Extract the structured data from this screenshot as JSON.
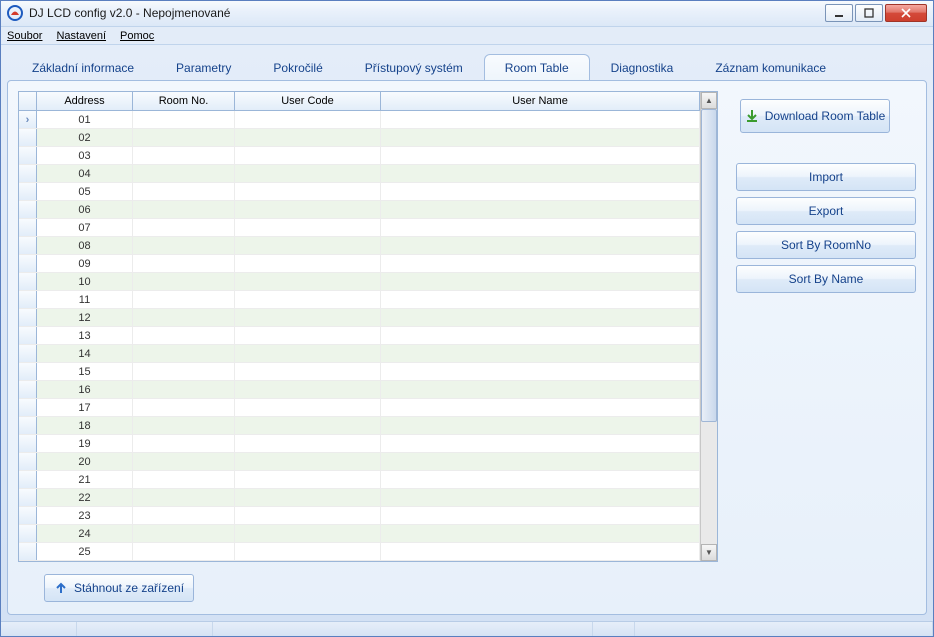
{
  "window": {
    "title": "DJ LCD config v2.0 - Nepojmenované"
  },
  "menu": {
    "file": "Soubor",
    "settings": "Nastavení",
    "help": "Pomoc"
  },
  "tabs": [
    {
      "label": "Základní informace"
    },
    {
      "label": "Parametry"
    },
    {
      "label": "Pokročilé"
    },
    {
      "label": "Přístupový systém"
    },
    {
      "label": "Room Table",
      "active": true
    },
    {
      "label": "Diagnostika"
    },
    {
      "label": "Záznam komunikace"
    }
  ],
  "grid": {
    "headers": {
      "address": "Address",
      "room": "Room No.",
      "code": "User Code",
      "name": "User Name"
    },
    "rows": [
      {
        "addr": "01"
      },
      {
        "addr": "02"
      },
      {
        "addr": "03"
      },
      {
        "addr": "04"
      },
      {
        "addr": "05"
      },
      {
        "addr": "06"
      },
      {
        "addr": "07"
      },
      {
        "addr": "08"
      },
      {
        "addr": "09"
      },
      {
        "addr": "10"
      },
      {
        "addr": "11"
      },
      {
        "addr": "12"
      },
      {
        "addr": "13"
      },
      {
        "addr": "14"
      },
      {
        "addr": "15"
      },
      {
        "addr": "16"
      },
      {
        "addr": "17"
      },
      {
        "addr": "18"
      },
      {
        "addr": "19"
      },
      {
        "addr": "20"
      },
      {
        "addr": "21"
      },
      {
        "addr": "22"
      },
      {
        "addr": "23"
      },
      {
        "addr": "24"
      },
      {
        "addr": "25"
      }
    ]
  },
  "side": {
    "download": "Download Room Table",
    "import": "Import",
    "export": "Export",
    "sortRoom": "Sort By RoomNo",
    "sortName": "Sort By Name"
  },
  "bottom": {
    "download_device": "Stáhnout ze zařízení"
  }
}
